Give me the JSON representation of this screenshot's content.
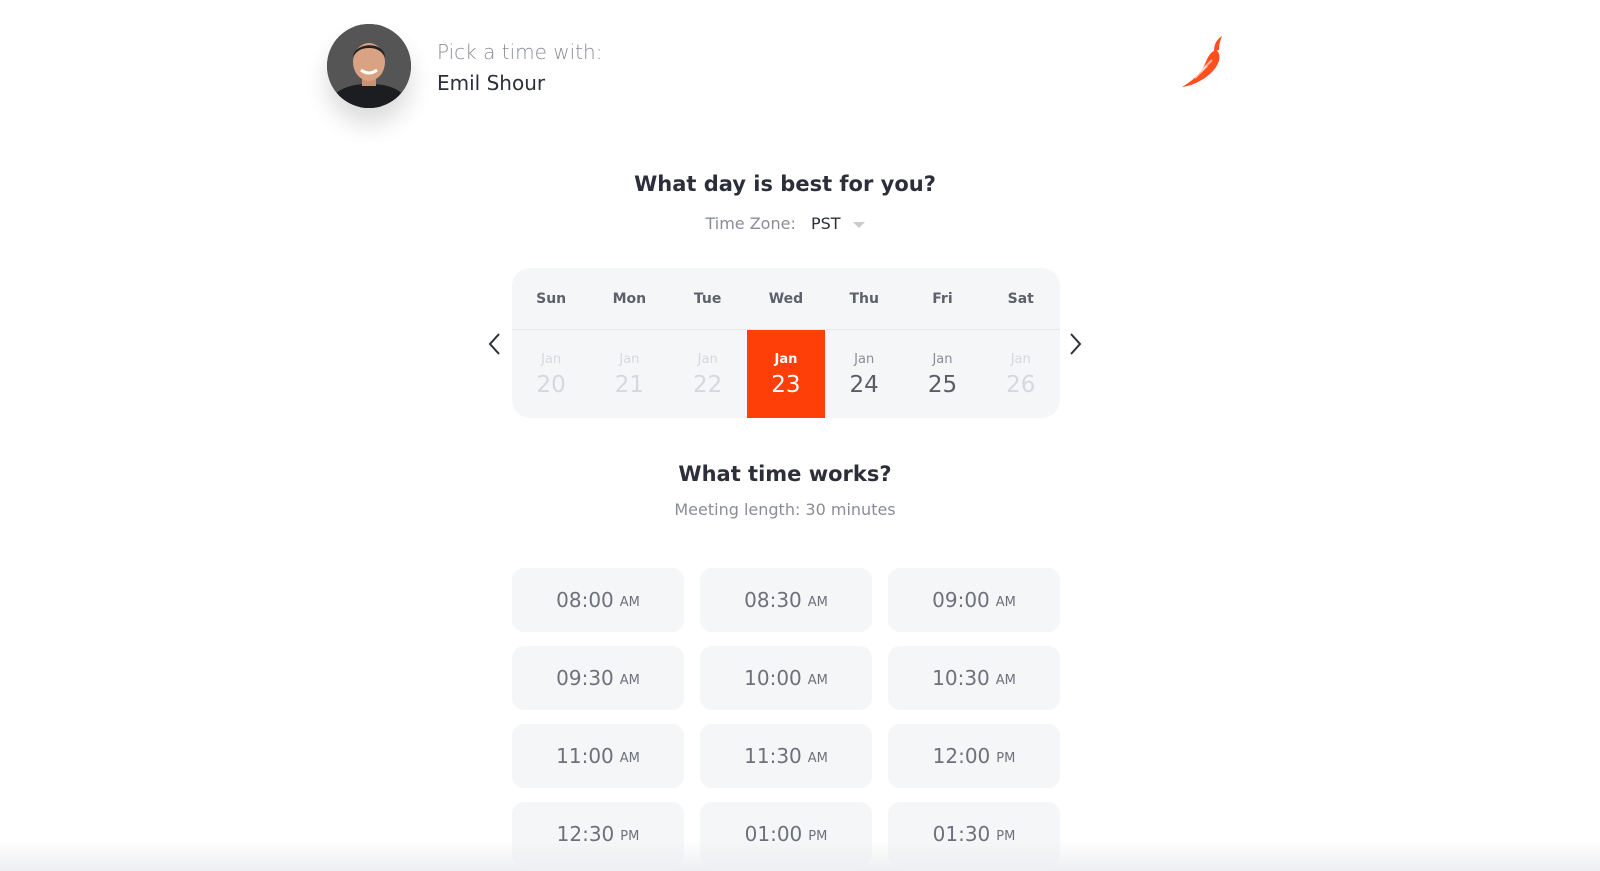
{
  "header": {
    "pick_label": "Pick a time with:",
    "host_name": "Emil Shour",
    "avatar_icon": "person-photo-icon",
    "logo_icon": "chili-pepper-logo-icon",
    "logo_color": "#ff4f1f"
  },
  "day_section": {
    "title": "What day is best for you?",
    "timezone_label": "Time Zone:",
    "timezone_value": "PST"
  },
  "calendar": {
    "days_of_week": [
      "Sun",
      "Mon",
      "Tue",
      "Wed",
      "Thu",
      "Fri",
      "Sat"
    ],
    "dates": [
      {
        "month": "Jan",
        "day": "20",
        "state": "disabled"
      },
      {
        "month": "Jan",
        "day": "21",
        "state": "disabled"
      },
      {
        "month": "Jan",
        "day": "22",
        "state": "disabled"
      },
      {
        "month": "Jan",
        "day": "23",
        "state": "selected"
      },
      {
        "month": "Jan",
        "day": "24",
        "state": "available"
      },
      {
        "month": "Jan",
        "day": "25",
        "state": "available"
      },
      {
        "month": "Jan",
        "day": "26",
        "state": "disabled"
      }
    ],
    "prev_icon": "chevron-left-icon",
    "next_icon": "chevron-right-icon",
    "selected_color": "#ff3f07"
  },
  "time_section": {
    "title": "What time works?",
    "meeting_length": "Meeting length: 30 minutes"
  },
  "slots": [
    {
      "time": "08:00",
      "period": "AM"
    },
    {
      "time": "08:30",
      "period": "AM"
    },
    {
      "time": "09:00",
      "period": "AM"
    },
    {
      "time": "09:30",
      "period": "AM"
    },
    {
      "time": "10:00",
      "period": "AM"
    },
    {
      "time": "10:30",
      "period": "AM"
    },
    {
      "time": "11:00",
      "period": "AM"
    },
    {
      "time": "11:30",
      "period": "AM"
    },
    {
      "time": "12:00",
      "period": "PM"
    },
    {
      "time": "12:30",
      "period": "PM"
    },
    {
      "time": "01:00",
      "period": "PM"
    },
    {
      "time": "01:30",
      "period": "PM"
    }
  ]
}
